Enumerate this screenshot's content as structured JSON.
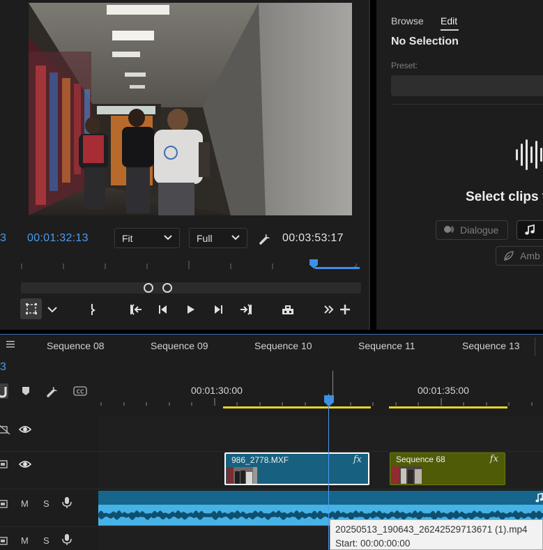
{
  "program_monitor": {
    "edge_timecode": "3",
    "current_timecode": "00:01:32:13",
    "duration_timecode": "00:03:53:17",
    "zoom_select": {
      "value": "Fit",
      "icon": "chevron-down-icon"
    },
    "resolution_select": {
      "value": "Full",
      "icon": "chevron-down-icon"
    },
    "settings_icon": "wrench-icon",
    "transport_icons": [
      "safe-margins-icon",
      "chevron-down-icon",
      "add-marker-icon",
      "go-to-in-icon",
      "step-back-icon",
      "play-icon",
      "step-forward-icon",
      "go-to-out-icon",
      "export-frame-icon",
      "more-icon",
      "add-button-icon"
    ]
  },
  "essential_sound": {
    "tabs": [
      {
        "label": "Browse"
      },
      {
        "label": "Edit",
        "active": true
      }
    ],
    "selection_status": "No Selection",
    "preset_label": "Preset:",
    "prompt": "Select clips t",
    "type_buttons": [
      {
        "label": "Dialogue",
        "icon": "speech-icon"
      },
      {
        "label": "",
        "icon": "music-note-icon"
      },
      {
        "label": "Amb",
        "icon": "leaf-icon"
      }
    ]
  },
  "timeline": {
    "edge_timecode": "3",
    "sequence_tabs": [
      "Sequence 08",
      "Sequence 09",
      "Sequence 10",
      "Sequence 11",
      "Sequence 13"
    ],
    "ruler_labels": [
      "00:01:30:00",
      "00:01:35:00"
    ],
    "tools": [
      "snap-icon",
      "marker-icon",
      "wrench-icon",
      "captions-icon"
    ],
    "tracks": [
      {
        "id": "v2",
        "controls": [
          "film-icon",
          "eye-icon"
        ]
      },
      {
        "id": "v1",
        "controls": [
          "film-icon",
          "eye-icon"
        ]
      },
      {
        "id": "a1",
        "mute": "M",
        "solo": "S",
        "controls": [
          "microphone-icon"
        ]
      },
      {
        "id": "a2",
        "mute": "M",
        "solo": "S",
        "controls": [
          "microphone-icon"
        ]
      }
    ],
    "clips": [
      {
        "name": "986_2778.MXF",
        "fx": "fx",
        "selected": true,
        "color": "#17607f"
      },
      {
        "name": "Sequence 68",
        "fx": "fx",
        "color": "#4f5b06"
      }
    ],
    "tooltip": {
      "filename": "20250513_190643_26242529713671 (1).mp4",
      "start": "Start: 00:00:00:00"
    },
    "colors": {
      "accent": "#4b9cf0",
      "work_area": "#e5d622",
      "audio_clip": "#15658d"
    }
  }
}
